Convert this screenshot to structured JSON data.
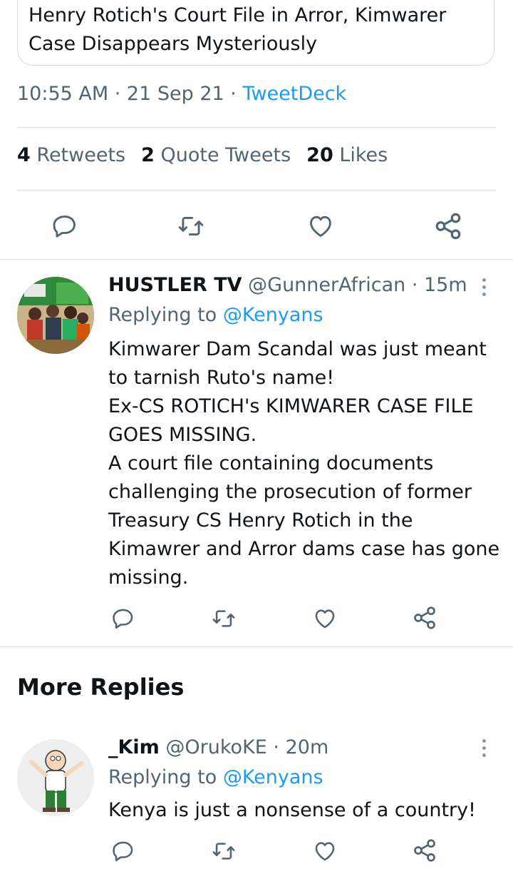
{
  "quoted_card": {
    "title": "Henry Rotich's Court File in Arror, Kimwarer Case Disappears Mysteriously"
  },
  "main_tweet": {
    "time": "10:55 AM",
    "sep1": " · ",
    "date": "21 Sep 21",
    "sep2": " · ",
    "source": "TweetDeck",
    "stats": {
      "retweets_count": "4",
      "retweets_label": "Retweets",
      "quotes_count": "2",
      "quotes_label": "Quote Tweets",
      "likes_count": "20",
      "likes_label": "Likes"
    }
  },
  "replies": [
    {
      "name": "HUSTLER TV",
      "handle": "@GunnerAfrican",
      "sep": " · ",
      "time": "15m",
      "replying_label": "Replying to",
      "replying_to": "@Kenyans",
      "text": "Kimwarer Dam Scandal was just meant\nto tarnish Ruto's name!\nEx-CS ROTICH's KIMWARER CASE FILE\nGOES MISSING.\nA court file containing documents\nchallenging the prosecution of former\nTreasury CS Henry Rotich in the\nKimawrer and Arror dams case has gone\nmissing."
    },
    {
      "name": "_Kim",
      "handle": "@OrukoKE",
      "sep": " · ",
      "time": "20m",
      "replying_label": "Replying to",
      "replying_to": "@Kenyans",
      "text": "Kenya is just a nonsense of a country!"
    }
  ],
  "more_replies_title": "More Replies",
  "icons": {
    "reply": "speech-bubble-icon",
    "retweet": "retweet-icon",
    "like": "heart-icon",
    "share": "share-icon",
    "more": "vertical-dots-icon"
  },
  "colors": {
    "link": "#1d9bf0",
    "secondary_text": "#536471",
    "primary_text": "#0f1419",
    "divider": "#dde3e7"
  }
}
